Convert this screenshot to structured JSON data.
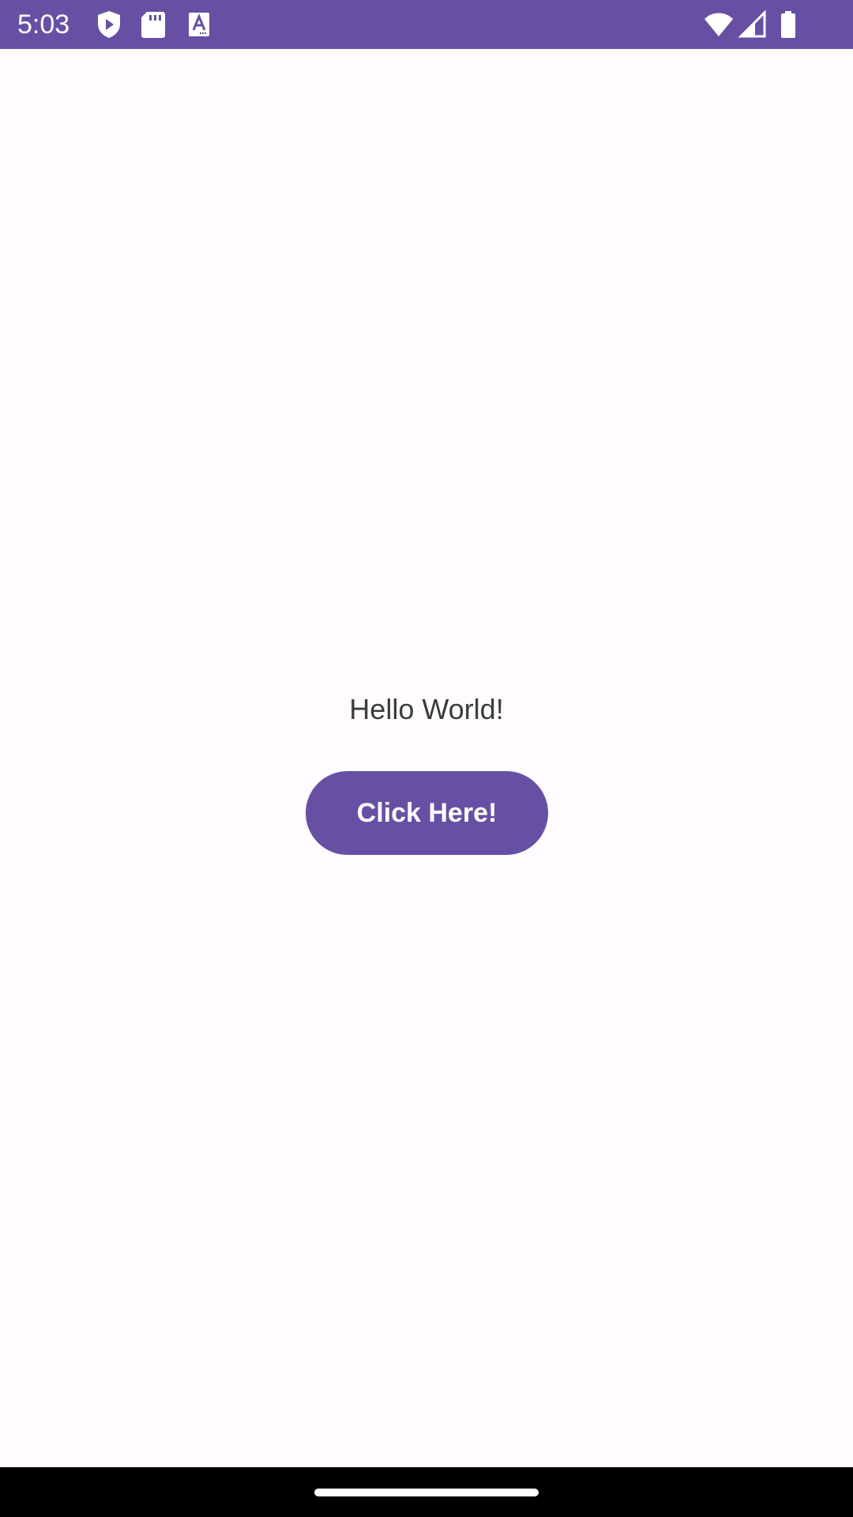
{
  "status_bar": {
    "time": "5:03",
    "background_color": "#6750A4",
    "left_icons": [
      "play-protect-icon",
      "sd-card-icon",
      "font-a-icon"
    ],
    "right_icons": [
      "wifi-icon",
      "cell-signal-icon",
      "battery-icon"
    ]
  },
  "main": {
    "greeting": "Hello World!",
    "button_label": "Click Here!",
    "accent_color": "#6750A4",
    "background_color": "#FFFBFE"
  },
  "nav_bar": {
    "background_color": "#000000"
  }
}
